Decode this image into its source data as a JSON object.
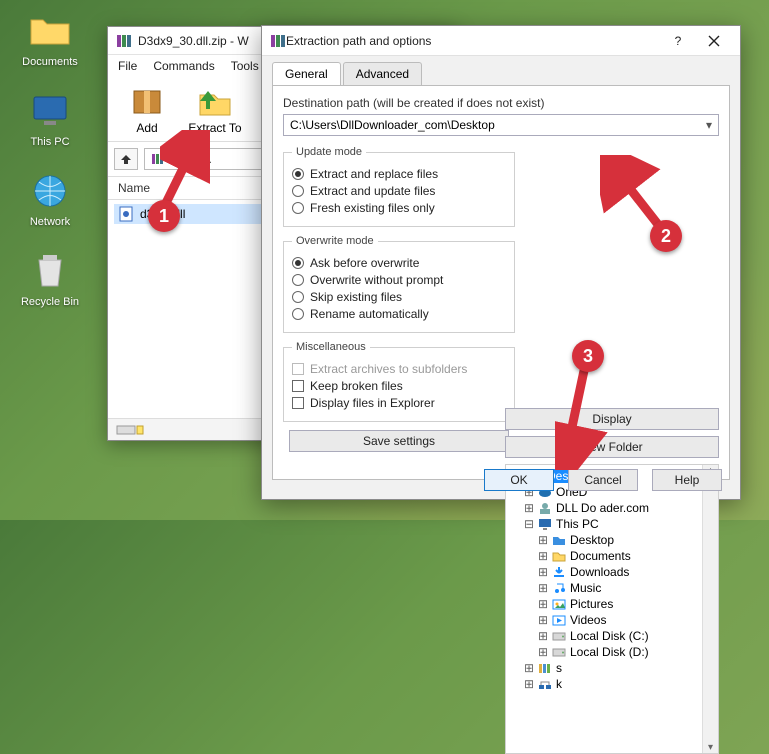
{
  "desktop": {
    "icons": [
      {
        "label": "Documents"
      },
      {
        "label": "This PC"
      },
      {
        "label": "Network"
      },
      {
        "label": "Recycle Bin"
      }
    ]
  },
  "winrar": {
    "title": "D3dx9_30.dll.zip - W",
    "menu": [
      "File",
      "Commands",
      "Tools"
    ],
    "toolbar": {
      "add": "Add",
      "extract_to": "Extract To"
    },
    "path_file": "dx9_30.",
    "list_header": "Name",
    "file_row": "d3       30.dll"
  },
  "dialog": {
    "title": "Extraction path and options",
    "help_icon": "?",
    "tabs": {
      "general": "General",
      "advanced": "Advanced"
    },
    "dest_label": "Destination path (will be created if does not exist)",
    "dest_value": "C:\\Users\\DllDownloader_com\\Desktop",
    "display_btn": "Display",
    "newfolder_btn": "New Folder",
    "update": {
      "legend": "Update mode",
      "o1": "Extract and replace files",
      "o2": "Extract and update files",
      "o3": "Fresh existing files only"
    },
    "overwrite": {
      "legend": "Overwrite mode",
      "o1": "Ask before overwrite",
      "o2": "Overwrite without prompt",
      "o3": "Skip existing files",
      "o4": "Rename automatically"
    },
    "misc": {
      "legend": "Miscellaneous",
      "o1": "Extract archives to subfolders",
      "o2": "Keep broken files",
      "o3": "Display files in Explorer"
    },
    "save": "Save settings",
    "tree": [
      {
        "exp": "–",
        "label": "Desktop",
        "depth": 0,
        "sel": "sel2",
        "icon": "desktop"
      },
      {
        "exp": "+",
        "label": "OneD",
        "depth": 1,
        "icon": "cloud"
      },
      {
        "exp": "+",
        "label": "DLL Do        ader.com",
        "depth": 1,
        "icon": "user"
      },
      {
        "exp": "–",
        "label": "This PC",
        "depth": 1,
        "icon": "pc"
      },
      {
        "exp": "+",
        "label": "Desktop",
        "depth": 2,
        "icon": "folder-blue"
      },
      {
        "exp": "+",
        "label": "Documents",
        "depth": 2,
        "icon": "folder"
      },
      {
        "exp": "+",
        "label": "Downloads",
        "depth": 2,
        "icon": "down"
      },
      {
        "exp": "+",
        "label": "Music",
        "depth": 2,
        "icon": "music"
      },
      {
        "exp": "+",
        "label": "Pictures",
        "depth": 2,
        "icon": "pic"
      },
      {
        "exp": "+",
        "label": "Videos",
        "depth": 2,
        "icon": "vid"
      },
      {
        "exp": "+",
        "label": "Local Disk (C:)",
        "depth": 2,
        "icon": "disk"
      },
      {
        "exp": "+",
        "label": "Local Disk (D:)",
        "depth": 2,
        "icon": "disk"
      },
      {
        "exp": "+",
        "label": "s",
        "depth": 1,
        "icon": "lib"
      },
      {
        "exp": "+",
        "label": "k",
        "depth": 1,
        "icon": "net"
      }
    ],
    "ok": "OK",
    "cancel": "Cancel",
    "helpb": "Help"
  },
  "steps": {
    "1": "1",
    "2": "2",
    "3": "3"
  }
}
